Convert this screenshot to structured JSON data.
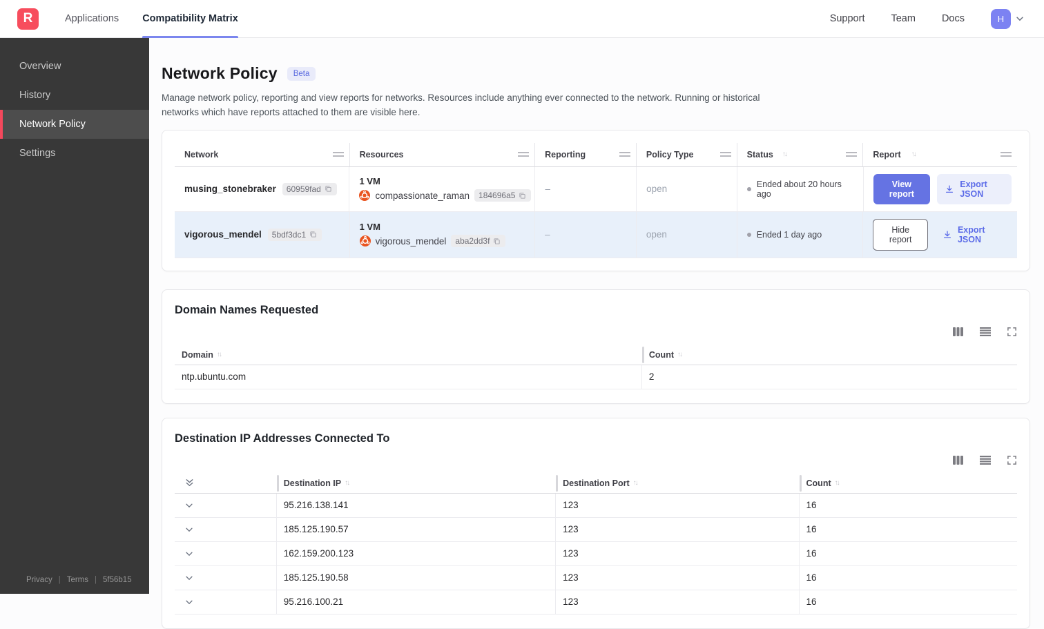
{
  "nav": {
    "logo": "R",
    "tabs": [
      {
        "label": "Applications"
      },
      {
        "label": "Compatibility Matrix"
      }
    ],
    "links": [
      {
        "label": "Support"
      },
      {
        "label": "Team"
      },
      {
        "label": "Docs"
      }
    ],
    "avatar": "H"
  },
  "sidebar": {
    "items": [
      {
        "label": "Overview"
      },
      {
        "label": "History"
      },
      {
        "label": "Network Policy"
      },
      {
        "label": "Settings"
      }
    ],
    "footer": {
      "privacy": "Privacy",
      "terms": "Terms",
      "build": "5f56b15"
    }
  },
  "page": {
    "title": "Network Policy",
    "badge": "Beta",
    "description": "Manage network policy, reporting and view reports for networks. Resources include anything ever connected to the network. Running or historical networks which have reports attached to them are visible here."
  },
  "networks_table": {
    "columns": [
      {
        "label": "Network"
      },
      {
        "label": "Resources"
      },
      {
        "label": "Reporting"
      },
      {
        "label": "Policy Type"
      },
      {
        "label": "Status",
        "sortable": true
      },
      {
        "label": "Report",
        "sortable": true
      }
    ],
    "rows": [
      {
        "name": "musing_stonebraker",
        "id": "60959fad",
        "vm_count": "1 VM",
        "resource_name": "compassionate_raman",
        "resource_id": "184696a5",
        "reporting": "–",
        "policy_type": "open",
        "status": "Ended about 20 hours ago",
        "report_button": "View report",
        "export_label": "Export JSON"
      },
      {
        "name": "vigorous_mendel",
        "id": "5bdf3dc1",
        "vm_count": "1 VM",
        "resource_name": "vigorous_mendel",
        "resource_id": "aba2dd3f",
        "reporting": "–",
        "policy_type": "open",
        "status": "Ended 1 day ago",
        "report_button": "Hide report",
        "export_label": "Export JSON"
      }
    ]
  },
  "domains_card": {
    "title": "Domain Names Requested",
    "columns": [
      {
        "label": "Domain"
      },
      {
        "label": "Count"
      }
    ],
    "rows": [
      {
        "domain": "ntp.ubuntu.com",
        "count": "2"
      }
    ]
  },
  "destinations_card": {
    "title": "Destination IP Addresses Connected To",
    "columns": [
      {
        "label": "Destination IP"
      },
      {
        "label": "Destination Port"
      },
      {
        "label": "Count"
      }
    ],
    "rows": [
      {
        "ip": "95.216.138.141",
        "port": "123",
        "count": "16"
      },
      {
        "ip": "185.125.190.57",
        "port": "123",
        "count": "16"
      },
      {
        "ip": "162.159.200.123",
        "port": "123",
        "count": "16"
      },
      {
        "ip": "185.125.190.58",
        "port": "123",
        "count": "16"
      },
      {
        "ip": "95.216.100.21",
        "port": "123",
        "count": "16"
      }
    ]
  },
  "icons": {
    "copy-icon": "overlapping squares",
    "download-icon": "arrow into tray",
    "sort-icon": "↑↓",
    "column-resize-handle": "=",
    "columns-icon": "three vertical bars",
    "rows-icon": "four horizontal lines",
    "fullscreen-icon": "corner brackets",
    "chevron-down-icon": "⌄",
    "expand-all-icon": "double chevron down",
    "ubuntu-icon": "orange circle of friends"
  },
  "colors": {
    "accent_indigo": "#6573e3",
    "logo_red": "#f74d5d",
    "sidebar_active_accent": "#f4485c",
    "row_highlight": "#e8f0fa",
    "ubuntu_orange": "#e95420",
    "avatar_purple": "#7c82f2",
    "beta_badge_bg": "#e9ebfa"
  }
}
